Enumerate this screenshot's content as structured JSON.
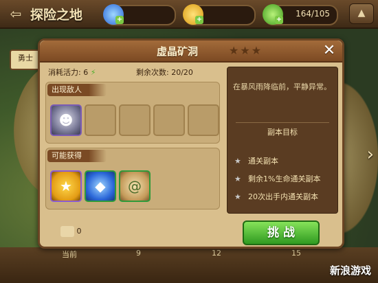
{
  "topbar": {
    "title": "探险之地",
    "energy": "164/105",
    "back_icon": "back-arrow-icon"
  },
  "side_tab": "勇士",
  "dialog": {
    "title": "虚晶矿洞",
    "stars": "★★★",
    "close_icon": "close-icon",
    "stamina_label": "消耗活力: 6",
    "remaining_label": "剩余次数: 20/20",
    "enemies_header": "出现敌人",
    "loot_header": "可能获得",
    "description": "在暴风雨降临前，平静异常。",
    "goals_title": "副本目标",
    "goals": [
      "通关副本",
      "剩余1%生命通关副本",
      "20次出手内通关副本"
    ],
    "key_count": "0",
    "fight_label": "挑 战"
  },
  "track": {
    "label": "当前",
    "ticks": [
      "9",
      "12",
      "15"
    ]
  },
  "watermark": "新浪游戏"
}
